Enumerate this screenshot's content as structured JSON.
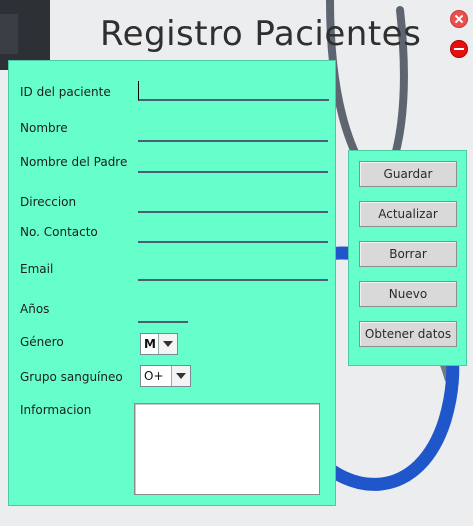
{
  "window": {
    "title": "Registro Pacientes"
  },
  "form": {
    "labels": {
      "id": "ID del paciente",
      "nombre": "Nombre",
      "padre": "Nombre del Padre",
      "direccion": "Direccion",
      "contacto": "No.  Contacto",
      "email": "Email",
      "anos": "Años",
      "genero": "Género",
      "grupo": "Grupo sanguíneo",
      "informacion": "Informacion"
    },
    "values": {
      "id": "",
      "nombre": "",
      "padre": "",
      "direccion": "",
      "contacto": "",
      "email": "",
      "anos": "",
      "informacion": ""
    },
    "genero_selected": "M",
    "grupo_selected": "O+"
  },
  "buttons": {
    "guardar": "Guardar",
    "actualizar": "Actualizar",
    "borrar": "Borrar",
    "nuevo": "Nuevo",
    "obtener": "Obtener datos"
  },
  "colors": {
    "panel": "#66ffcc",
    "close": "#e9504e",
    "minimize": "#e3110f"
  }
}
